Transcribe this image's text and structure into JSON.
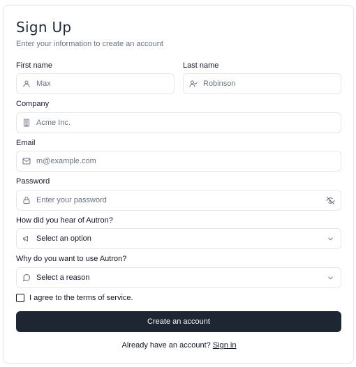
{
  "form": {
    "title": "Sign Up",
    "subtitle": "Enter your information to create an account",
    "first_name": {
      "label": "First name",
      "placeholder": "Max",
      "icon": "user-icon"
    },
    "last_name": {
      "label": "Last name",
      "placeholder": "Robinson",
      "icon": "user-check-icon"
    },
    "company": {
      "label": "Company",
      "placeholder": "Acme Inc.",
      "icon": "building-icon"
    },
    "email": {
      "label": "Email",
      "placeholder": "m@example.com",
      "icon": "mail-icon"
    },
    "password": {
      "label": "Password",
      "placeholder": "Enter your password",
      "icon": "lock-icon",
      "toggle_icon": "eye-off-icon"
    },
    "source": {
      "label": "How did you hear of Autron?",
      "selected": "Select an option",
      "icon": "megaphone-icon"
    },
    "reason": {
      "label": "Why do you want to use Autron?",
      "selected": "Select a reason",
      "icon": "message-circle-icon"
    },
    "terms": {
      "label": "I agree to the terms of service.",
      "checked": false
    },
    "submit_label": "Create an account",
    "footer_text": "Already have an account?",
    "signin_label": "Sign in"
  },
  "colors": {
    "button_bg": "#1e2533",
    "border": "#e5e7eb",
    "muted_text": "#6b7280"
  }
}
